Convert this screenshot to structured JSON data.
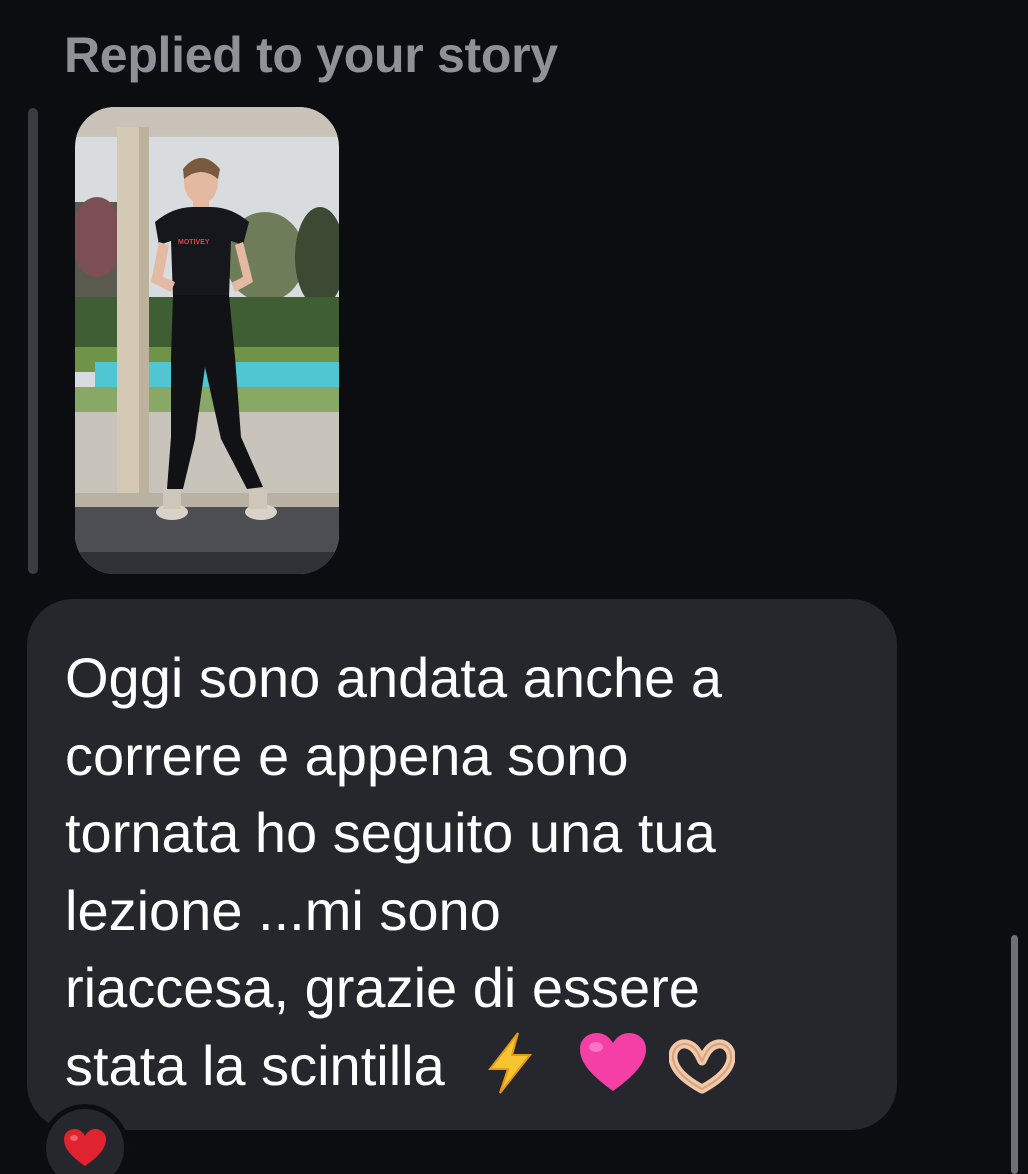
{
  "reply_header": {
    "label": "Replied to your story"
  },
  "story": {
    "shirt_text": "MOTIVEY"
  },
  "message": {
    "lines": [
      "Oggi sono andata anche a",
      "correre e appena sono",
      "tornata ho seguito una tua",
      "lezione ...mi sono",
      "riaccesa, grazie di essere",
      "stata la scintilla"
    ],
    "trailing_emojis": [
      "lightning-emoji",
      "pink-heart-emoji",
      "heart-hands-emoji"
    ]
  },
  "reaction": {
    "emoji": "red-heart-emoji"
  },
  "colors": {
    "background": "#0b0d11",
    "bubble": "#25272c",
    "label": "#8e9198",
    "text": "#ffffff",
    "reaction_heart": "#e0242f",
    "pink_heart": "#f43fa7",
    "lightning": "#f7c531"
  }
}
